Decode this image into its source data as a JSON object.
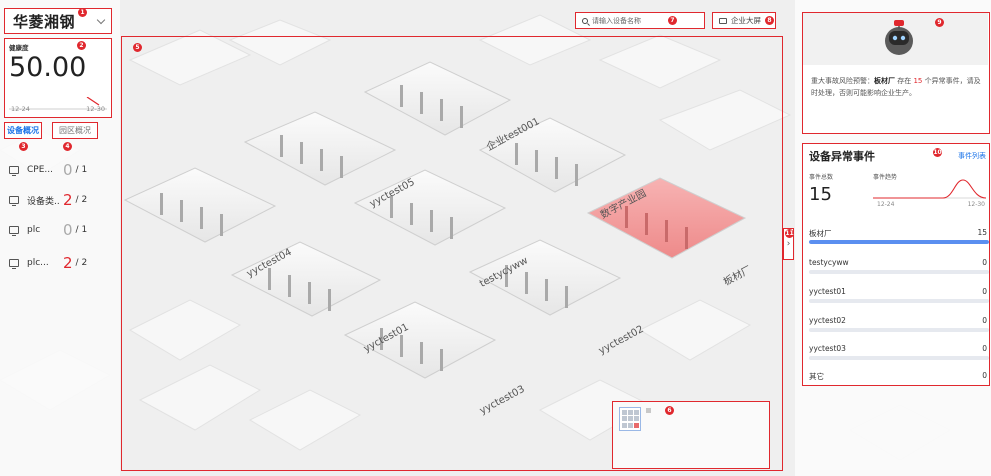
{
  "company": {
    "name": "华菱湘钢"
  },
  "health": {
    "label": "健康度",
    "value": "50.00",
    "x_start": "12-24",
    "x_end": "12-30"
  },
  "tabs": [
    {
      "label": "设备概况",
      "active": true
    },
    {
      "label": "园区概况",
      "active": false
    }
  ],
  "devices": [
    {
      "name": "CPE...",
      "abnormal": "0",
      "total": "/ 1"
    },
    {
      "name": "设备类...",
      "abnormal": "2",
      "total": "/ 2"
    },
    {
      "name": "plc",
      "abnormal": "0",
      "total": "/ 1"
    },
    {
      "name": "plc...",
      "abnormal": "2",
      "total": "/ 2"
    }
  ],
  "markers": [
    "1",
    "2",
    "3",
    "4",
    "5",
    "6",
    "7",
    "8",
    "9",
    "10",
    "11"
  ],
  "search": {
    "placeholder": "请输入设备名称"
  },
  "screen_button": {
    "label": "企业大屏"
  },
  "collapse": {
    "icon": "›"
  },
  "alert": {
    "prefix": "重大事故风险预警：",
    "factory": "板材厂",
    "mid1": " 存在 ",
    "count": "15",
    "suffix": " 个异常事件，请及时处理，否则可能影响企业生产。"
  },
  "events": {
    "title": "设备异常事件",
    "link": "事件列表",
    "total_label": "事件总数",
    "trend_label": "事件趋势",
    "total": "15",
    "x_start": "12-24",
    "x_end": "12-30",
    "rows": [
      {
        "name": "板材厂",
        "count": "15",
        "fraction": 1.0
      },
      {
        "name": "testycyww",
        "count": "0",
        "fraction": 0
      },
      {
        "name": "yyctest01",
        "count": "0",
        "fraction": 0
      },
      {
        "name": "yyctest02",
        "count": "0",
        "fraction": 0
      },
      {
        "name": "yyctest03",
        "count": "0",
        "fraction": 0
      },
      {
        "name": "其它",
        "count": "0",
        "fraction": 0
      }
    ]
  },
  "districts": [
    {
      "name": "企业test001"
    },
    {
      "name": "yyctest05"
    },
    {
      "name": "数字产业园"
    },
    {
      "name": "yyctest04"
    },
    {
      "name": "testycyww"
    },
    {
      "name": "板材厂"
    },
    {
      "name": "yyctest01"
    },
    {
      "name": "yyctest02"
    },
    {
      "name": "yyctest03"
    }
  ],
  "colors": {
    "accent": "#e0282e",
    "link": "#1a73e8",
    "bar": "#5b8ff0"
  }
}
